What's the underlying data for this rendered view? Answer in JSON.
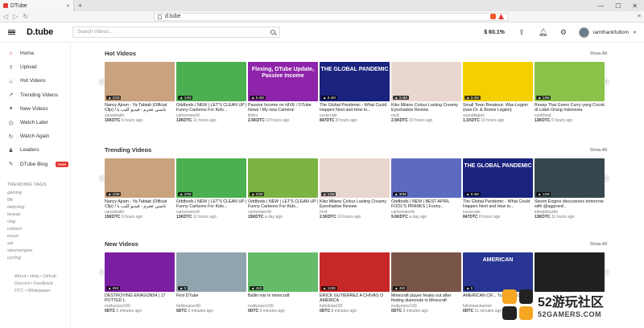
{
  "browser": {
    "tab_title": "DTube",
    "new_tab": "+",
    "url": "d.tube",
    "window_controls": [
      "—",
      "☐",
      "✕"
    ]
  },
  "header": {
    "logo": "D.tube",
    "search_placeholder": "Search Videos...",
    "price": "$ 60.1%",
    "username": "iamthankfultom"
  },
  "sidebar": {
    "items": [
      {
        "label": "Home",
        "icon": "home-icon",
        "glyph": "⌂"
      },
      {
        "label": "Upload",
        "icon": "upload-icon",
        "glyph": "⇪"
      },
      {
        "label": "Hot Videos",
        "icon": "fire-icon",
        "glyph": "♨"
      },
      {
        "label": "Trending Videos",
        "icon": "trending-icon",
        "glyph": "↗"
      },
      {
        "label": "New Videos",
        "icon": "star-icon",
        "glyph": "✦"
      },
      {
        "label": "Watch Later",
        "icon": "clock-icon",
        "glyph": "◷"
      },
      {
        "label": "Watch Again",
        "icon": "replay-icon",
        "glyph": "↻"
      },
      {
        "label": "Leaders",
        "icon": "users-icon",
        "glyph": "♟"
      },
      {
        "label": "DTube Blog",
        "icon": "blog-icon",
        "glyph": "✎",
        "badge": "New!"
      }
    ],
    "trending_tags_title": "TRENDING TAGS",
    "tags": [
      "gaming",
      "life",
      "dailyvlog",
      "beauty",
      "vlog",
      "cartoon",
      "music",
      "spt",
      "steemengine",
      "cycling"
    ],
    "footer": [
      "About • Help • Github",
      "Discord • Feedback",
      "DTC • Whitepaper"
    ]
  },
  "sections": [
    {
      "title": "Hot Videos",
      "show_all": "Show All",
      "videos": [
        {
          "title": "Nancy Ajram - Ya Tabtab (Official Clip) / نانسي عجرم - فيديو كليب يا طبطب",
          "author": "sanashakh",
          "value": "15KDTC",
          "time": "6 hours ago",
          "badge": "▲ 22M",
          "dur": "",
          "thumb": "#c9a27e",
          "big": ""
        },
        {
          "title": "Oddbods | NEW | LET'S CLEAN UP | Funny Cartoons For Kids...",
          "author": "cartoonworld",
          "value": "13KDTC",
          "time": "11 hours ago",
          "badge": "▲ 14M",
          "dur": "",
          "thumb": "#4caf50",
          "big": ""
        },
        {
          "title": "Passive Income on HIVE / DTube News / My new Camera!",
          "author": "litrfox",
          "value": "2.5KDTC",
          "time": "10 hours ago",
          "badge": "▲ 5.4M",
          "dur": "",
          "thumb": "#8e24aa",
          "big": "Flexing, DTube Update, Passive Income"
        },
        {
          "title": "The Global Pandemic - What Could Happen Next and How to...",
          "author": "cuvacrate",
          "value": "847DTC",
          "time": "8 hours ago",
          "badge": "▲ 9.4M",
          "dur": "",
          "thumb": "#1a237e",
          "big": "THE GLOBAL PANDEMIC"
        },
        {
          "title": "Kiko Milano Colour Lasting Creamy Eyeshadow Review",
          "author": "mcd",
          "value": "2.5KDTC",
          "time": "10 hours ago",
          "badge": "▲ 3.4M",
          "dur": "",
          "thumb": "#e8d6cf",
          "big": ""
        },
        {
          "title": "Small Town Breakout- Wax-Legion (wax-Dr. & Borele Legion)",
          "author": "soundlegion",
          "value": "1.1KDTC",
          "time": "10 hours ago",
          "badge": "▲ 2.4M",
          "dur": "",
          "thumb": "#f4d000",
          "big": ""
        },
        {
          "title": "Resep Thai Green Curry yang Cocok di Lidah Orang Indonesia",
          "author": "cookfood",
          "value": "13KDTC",
          "time": "6 hours ago",
          "badge": "▲ 14M",
          "dur": "",
          "thumb": "#8bc34a",
          "big": ""
        }
      ]
    },
    {
      "title": "Trending Videos",
      "show_all": "Show All",
      "videos": [
        {
          "title": "Nancy Ajram - Ya Tabtab (Official Clip) / نانسي عجرم - فيديو كليب يا طبطب",
          "author": "sanashakh",
          "value": "15KDTC",
          "time": "6 hours ago",
          "badge": "▲ 22M",
          "dur": "",
          "thumb": "#c9a27e",
          "big": ""
        },
        {
          "title": "Oddbods | NEW | LET'S CLEAN UP | Funny Cartoons For Kids...",
          "author": "cartoonworld",
          "value": "13KDTC",
          "time": "11 hours ago",
          "badge": "▲ 20M",
          "dur": "",
          "thumb": "#4caf50",
          "big": ""
        },
        {
          "title": "Oddbods | NEW | LET'S CLEAN UP | Funny Cartoons For Kids...",
          "author": "cartoonworld",
          "value": "15KDTC",
          "time": "a day ago",
          "badge": "▲ 22M",
          "dur": "",
          "thumb": "#7cb342",
          "big": ""
        },
        {
          "title": "Kiko Milano Colour Lasting Creamy Eyeshadow Review",
          "author": "mcd",
          "value": "2.5KDTC",
          "time": "10 hours ago",
          "badge": "▲ 14M",
          "dur": "",
          "thumb": "#e8d6cf",
          "big": ""
        },
        {
          "title": "Oddbods | NEW | BEST APRIL FOOL'S PRANKS | Funny...",
          "author": "cartoonworld",
          "value": "9.6KDTC",
          "time": "a day ago",
          "badge": "▲ 30M",
          "dur": "",
          "thumb": "#5c6bc0",
          "big": ""
        },
        {
          "title": "The Global Pandemic - What Could Happen Next and How to...",
          "author": "cuvacrate",
          "value": "847DTC",
          "time": "8 hours ago",
          "badge": "▲ 9.4M",
          "dur": "",
          "thumb": "#1a237e",
          "big": "THE GLOBAL PANDEMIC"
        },
        {
          "title": "Steem Engine discussions tomorrow with @aggroed...",
          "author": "intrepidsurfer",
          "value": "13KDTC",
          "time": "11 hours ago",
          "badge": "▲ 14M",
          "dur": "",
          "thumb": "#37474f",
          "big": ""
        }
      ]
    },
    {
      "title": "New Videos",
      "show_all": "Show All",
      "videos": [
        {
          "title": "DESTROYING ERAGON54 | 17 POTTED L",
          "author": "mallyorpor100",
          "value": "0DTC",
          "time": "5 minutes ago",
          "badge": "▲ 593",
          "dur": "",
          "thumb": "#7b1fa2",
          "big": ""
        },
        {
          "title": "First DTube",
          "author": "hellsourcer00",
          "value": "0DTC",
          "time": "6 minutes ago",
          "badge": "▲ 0",
          "dur": "",
          "thumb": "#90a4ae",
          "big": ""
        },
        {
          "title": "Ballin mix in minecraft",
          "author": "mallyorpor100",
          "value": "0DTC",
          "time": "6 minutes ago",
          "badge": "▲ 410",
          "dur": "",
          "thumb": "#66bb6a",
          "big": ""
        },
        {
          "title": "ERICK GUTIERREZ A CHIVAS O AMÉRICA",
          "author": "futbolista100",
          "value": "0DTC",
          "time": "8 minutes ago",
          "badge": "▲ 120K",
          "dur": "",
          "thumb": "#c62828",
          "big": ""
        },
        {
          "title": "Minecraft player freaks out after finding diamonds in Minecraft",
          "author": "mallyorpor100",
          "value": "0DTC",
          "time": "9 minutes ago",
          "badge": "▲ 450",
          "dur": "",
          "thumb": "#795548",
          "big": ""
        },
        {
          "title": "AMERICAN CR... Tuesday 3/3...",
          "author": "fullshowchannel",
          "value": "0DTC",
          "time": "11 minutes ago",
          "badge": "▲ 0",
          "dur": "",
          "thumb": "#283593",
          "big": "AMERICAN"
        },
        {
          "title": "",
          "author": "",
          "value": "",
          "time": "",
          "badge": "",
          "dur": "",
          "thumb": "#212121",
          "big": ""
        }
      ]
    }
  ],
  "watermark": {
    "text_cn": "52游玩社区",
    "text_en": "52GAMERS.COM"
  }
}
